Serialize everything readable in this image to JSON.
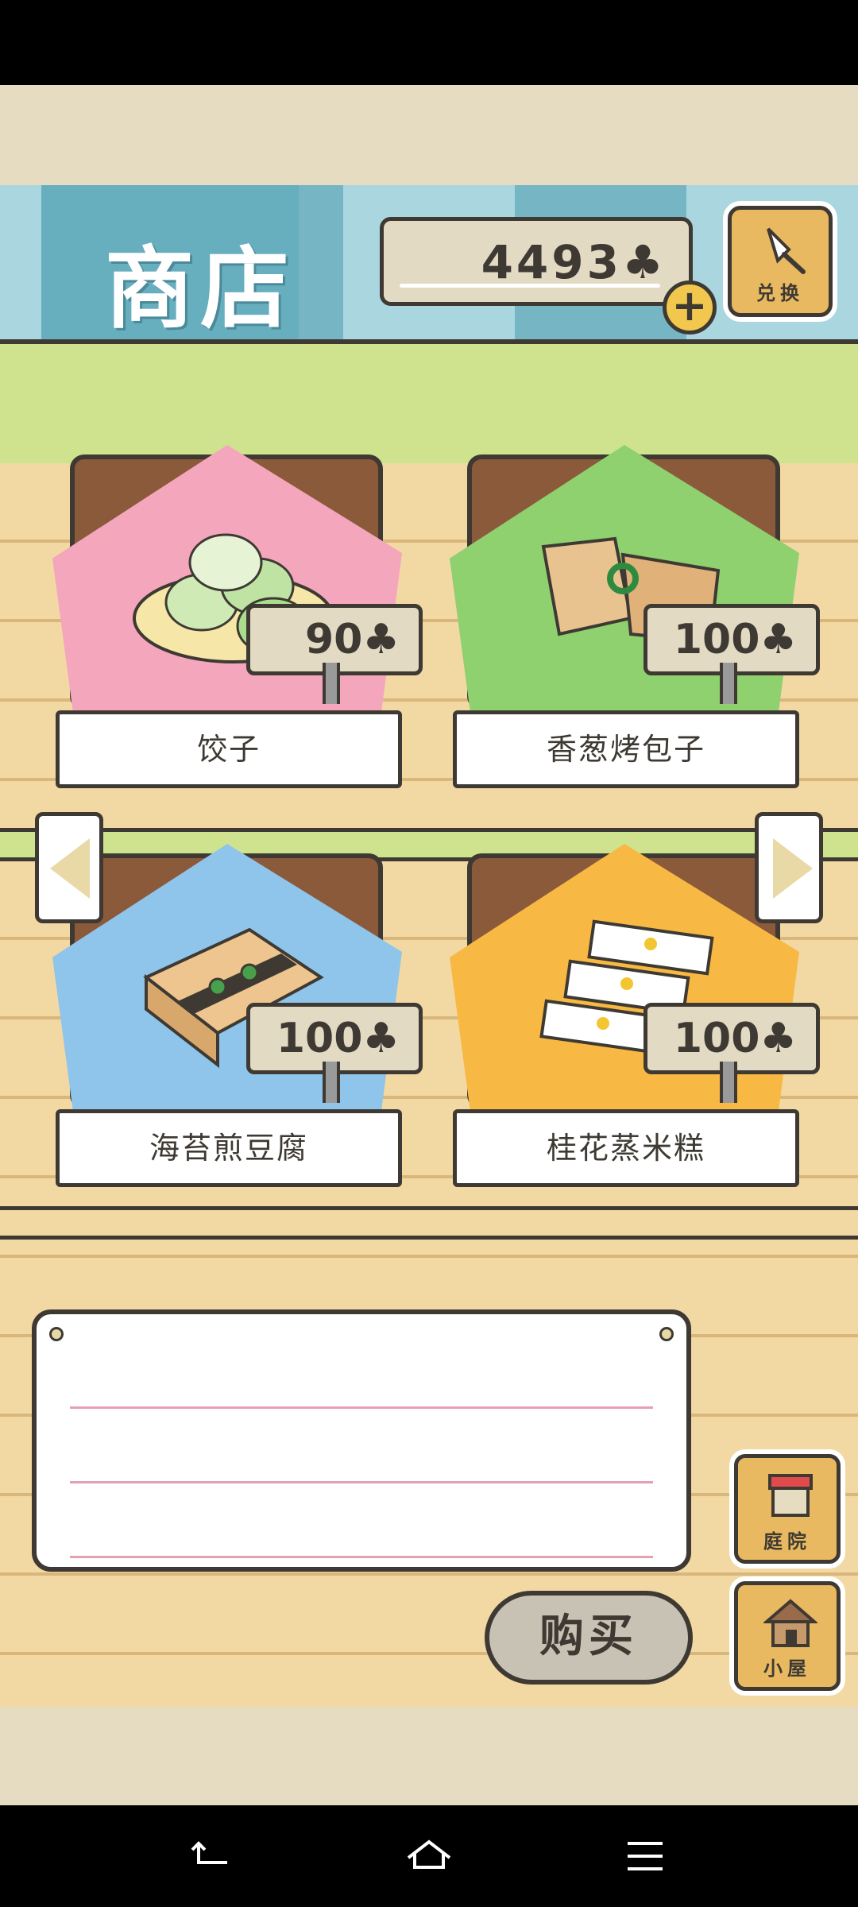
{
  "header": {
    "title": "商店",
    "coins": "4493",
    "coin_icon": "clover-icon",
    "add_coins_label": "+",
    "exchange_label": "兑换"
  },
  "items": [
    {
      "name": "饺子",
      "price": "90",
      "cloth_color": "#f4a6bd"
    },
    {
      "name": "香葱烤包子",
      "price": "100",
      "cloth_color": "#8fd06f"
    },
    {
      "name": "海苔煎豆腐",
      "price": "100",
      "cloth_color": "#8fc5ea"
    },
    {
      "name": "桂花蒸米糕",
      "price": "100",
      "cloth_color": "#f7b943"
    }
  ],
  "price_suffix": "♣",
  "message": {
    "text": ""
  },
  "buy_label": "购买",
  "nav": {
    "yard_label": "庭院",
    "house_label": "小屋"
  }
}
